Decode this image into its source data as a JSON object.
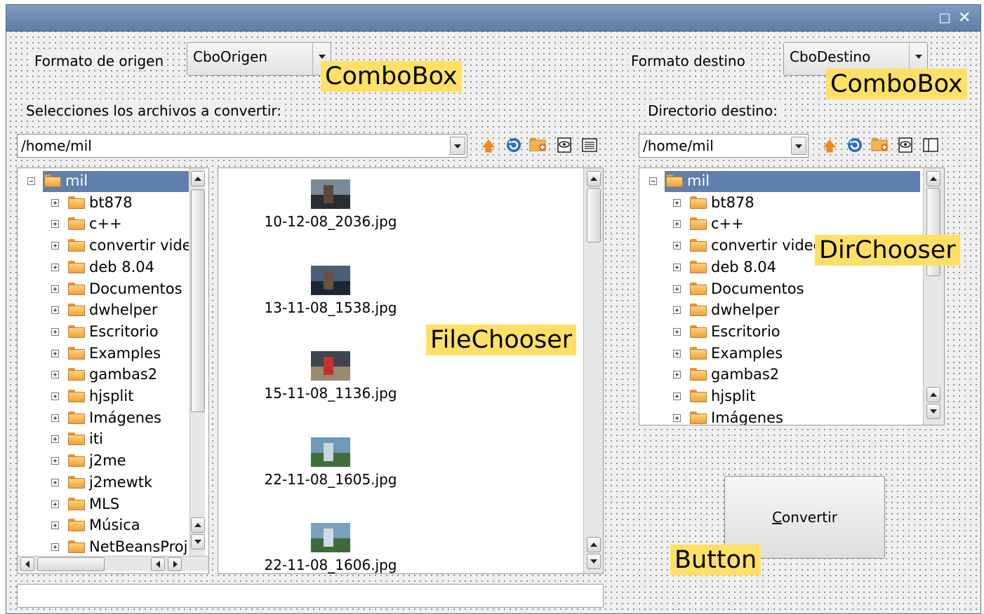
{
  "window": {
    "restore_icon": "square-icon",
    "close_icon": "x-icon"
  },
  "source": {
    "format_label": "Formato de origen",
    "combo_value": "CboOrigen",
    "select_label": "Selecciones los archivos a convertir:",
    "path": "/home/mil"
  },
  "dest": {
    "format_label": "Formato destino",
    "combo_value": "CboDestino",
    "dir_label": "Directorio destino:",
    "path": "/home/mil"
  },
  "tree_root": "mil",
  "source_tree": [
    "bt878",
    "c++",
    "convertir vide",
    "deb 8.04",
    "Documentos",
    "dwhelper",
    "Escritorio",
    "Examples",
    "gambas2",
    "hjsplit",
    "Imágenes",
    "iti",
    "j2me",
    "j2mewtk",
    "MLS",
    "Música",
    "NetBeansProj"
  ],
  "dest_tree": [
    "bt878",
    "c++",
    "convertir video",
    "deb 8.04",
    "Documentos",
    "dwhelper",
    "Escritorio",
    "Examples",
    "gambas2",
    "hjsplit",
    "Imágenes"
  ],
  "files": [
    "10-12-08_2036.jpg",
    "13-11-08_1538.jpg",
    "15-11-08_1136.jpg",
    "22-11-08_1605.jpg",
    "22-11-08_1606.jpg"
  ],
  "convert_button": {
    "mnemonic": "C",
    "rest": "onvertir"
  },
  "callouts": {
    "combobox1": "ComboBox",
    "combobox2": "ComboBox",
    "filechooser": "FileChooser",
    "dirchooser": "DirChooser",
    "button": "Button"
  },
  "colors": {
    "titlebar": "#6f8db5",
    "selection": "#5f80ad",
    "callout": "#ffe066"
  }
}
